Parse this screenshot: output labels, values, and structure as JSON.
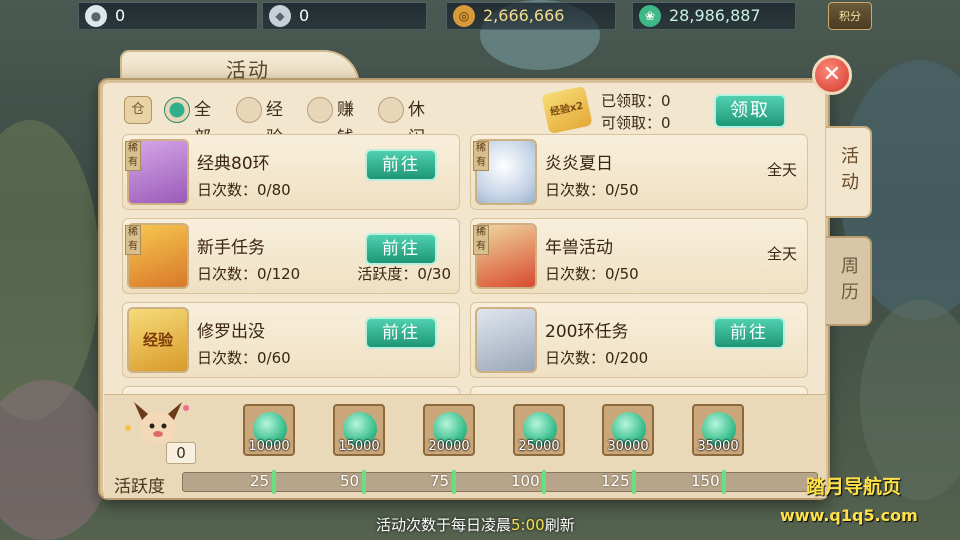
{
  "resources": [
    {
      "icon": "silver-coin-icon",
      "value": "0"
    },
    {
      "icon": "silver-ingot-icon",
      "value": "0"
    },
    {
      "icon": "copper-coin-icon",
      "value": "2,666,666"
    },
    {
      "icon": "jade-icon",
      "value": "28,986,887"
    }
  ],
  "score_button_label": "积分",
  "panel": {
    "title": "活动",
    "close_symbol": "✕",
    "side_tabs": [
      "活动",
      "周历"
    ]
  },
  "filters": {
    "lock_label": "仓",
    "options": [
      {
        "label": "全部",
        "checked": true
      },
      {
        "label": "经验",
        "checked": false
      },
      {
        "label": "赚钱",
        "checked": false
      },
      {
        "label": "休闲",
        "checked": false
      }
    ]
  },
  "claim": {
    "exp_badge": "经验x2",
    "claimed": "已领取：0",
    "claimable": "可领取：0",
    "button": "领取"
  },
  "activities": [
    {
      "name": "经典80环",
      "count": "日次数：0/80",
      "rare": "稀有",
      "action": "前往",
      "thumb": "purple-chest"
    },
    {
      "name": "炎炎夏日",
      "count": "日次数：0/50",
      "rare": "稀有",
      "time": "全天",
      "thumb": "snowball"
    },
    {
      "name": "新手任务",
      "count": "日次数：0/120",
      "active": "活跃度：0/30",
      "rare": "稀有",
      "action": "前往",
      "thumb": "gold-chest"
    },
    {
      "name": "年兽活动",
      "count": "日次数：0/50",
      "rare": "稀有",
      "time": "全天",
      "thumb": "firecracker"
    },
    {
      "name": "修罗出没",
      "count": "日次数：0/60",
      "action": "前往",
      "thumb": "exp-gourd",
      "thumb_label": "经验"
    },
    {
      "name": "200环任务",
      "count": "日次数：0/200",
      "action": "前往",
      "thumb": "silver-treasure"
    }
  ],
  "rewards": {
    "current_activity": "0",
    "chests": [
      "10000",
      "15000",
      "20000",
      "25000",
      "30000",
      "35000"
    ]
  },
  "activity_bar": {
    "label": "活跃度",
    "progress": 0,
    "milestones": [
      "25",
      "50",
      "75",
      "100",
      "125",
      "150"
    ]
  },
  "footer": {
    "before": "活动次数于每日凌晨",
    "time": "5:00",
    "after": "刷新"
  },
  "watermark": {
    "line1": "踏月导航页",
    "line2": "www.q1q5.com"
  },
  "colors": {
    "accent_green": "#2fb08a",
    "panel_bg": "#f2e6cf",
    "close_red": "#d0382c",
    "gold_text": "#f4dc8a"
  }
}
